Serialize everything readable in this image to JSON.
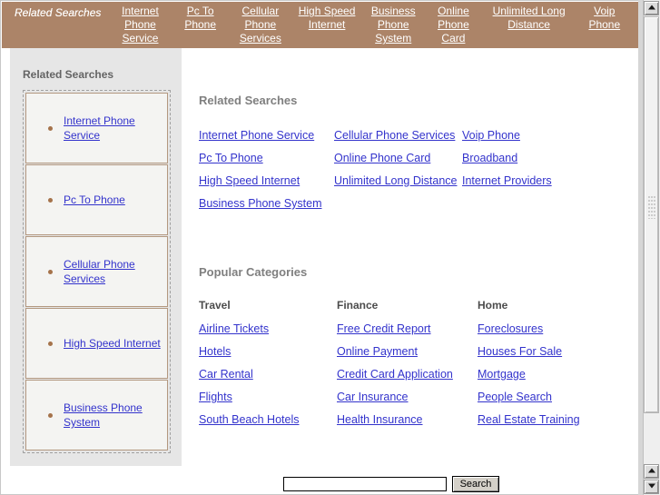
{
  "topbar": {
    "title": "Related Searches",
    "links": [
      "Internet Phone Service",
      "Pc To Phone",
      "Cellular Phone Services",
      "High Speed Internet",
      "Business Phone System",
      "Online Phone Card",
      "Unlimited Long Distance",
      "Voip Phone"
    ]
  },
  "sidebar": {
    "title": "Related Searches",
    "items": [
      "Internet Phone Service",
      "Pc To Phone",
      "Cellular Phone Services",
      "High Speed Internet",
      "Business Phone System"
    ]
  },
  "main": {
    "related_searches": {
      "heading": "Related Searches",
      "links": [
        "Internet Phone Service",
        "Cellular Phone Services",
        "Voip Phone",
        "Pc To Phone",
        "Online Phone Card",
        "Broadband",
        "High Speed Internet",
        "Unlimited Long Distance",
        "Internet Providers",
        "Business Phone System",
        "",
        ""
      ]
    },
    "popular_categories": {
      "heading": "Popular Categories",
      "columns": [
        {
          "title": "Travel",
          "links": [
            "Airline Tickets",
            "Hotels",
            "Car Rental",
            "Flights",
            "South Beach Hotels"
          ]
        },
        {
          "title": "Finance",
          "links": [
            "Free Credit Report",
            "Online Payment",
            "Credit Card Application",
            "Car Insurance",
            "Health Insurance"
          ]
        },
        {
          "title": "Home",
          "links": [
            "Foreclosures",
            "Houses For Sale",
            "Mortgage",
            "People Search",
            "Real Estate Training"
          ]
        }
      ]
    }
  },
  "search": {
    "value": "",
    "placeholder": "",
    "button_label": "Search"
  },
  "colors": {
    "topbar_background": "#ac8468",
    "topbar_link": "#ffffff",
    "sidebar_background": "#e6e6e6",
    "link": "#3333cc",
    "heading": "#7f7f7f",
    "bullet": "#a5734b",
    "item_border": "#b39880"
  }
}
